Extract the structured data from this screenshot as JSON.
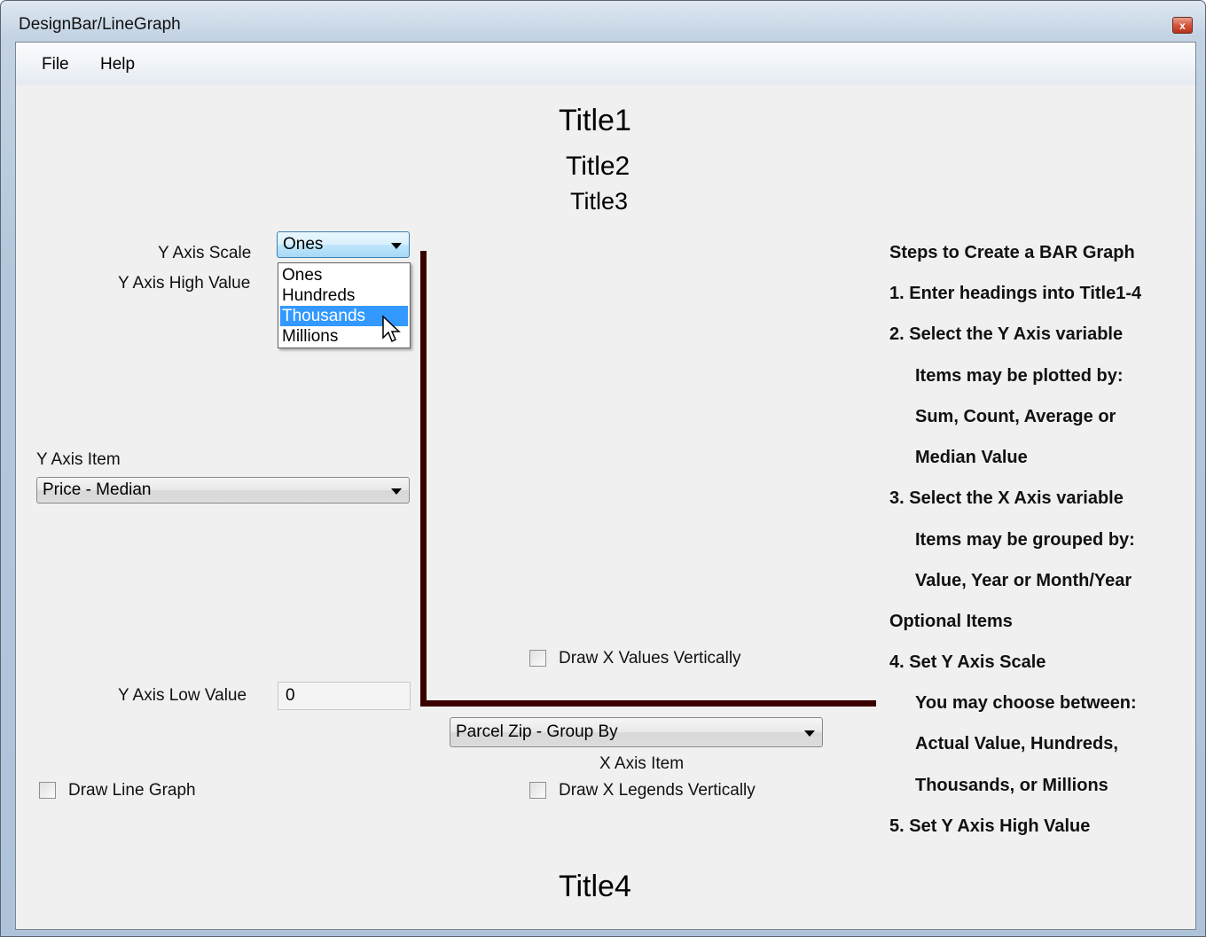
{
  "window": {
    "title": "DesignBar/LineGraph",
    "close_glyph": "x"
  },
  "menu": {
    "file": "File",
    "help": "Help"
  },
  "titles": {
    "title1": "Title1",
    "title2": "Title2",
    "title3": "Title3",
    "title4": "Title4"
  },
  "y_axis": {
    "scale_label": "Y Axis Scale",
    "scale_selected": "Ones",
    "scale_options": [
      "Ones",
      "Hundreds",
      "Thousands",
      "Millions"
    ],
    "scale_highlighted": "Thousands",
    "high_value_label": "Y Axis High Value",
    "item_label": "Y Axis Item",
    "item_selected": "Price - Median",
    "low_value_label": "Y Axis Low Value",
    "low_value": "0"
  },
  "x_axis": {
    "item_selected": "Parcel Zip - Group By",
    "item_label": "X Axis Item",
    "draw_values_vertically": "Draw X Values Vertically",
    "draw_legends_vertically": "Draw X Legends Vertically"
  },
  "draw_line_graph": "Draw Line Graph",
  "checkboxes": {
    "draw_line_graph": false,
    "draw_values_vertically": false,
    "draw_legends_vertically": false
  },
  "axis_color": "#3a0000",
  "steps": [
    "Steps to Create a BAR Graph",
    "1.  Enter headings into Title1-4",
    "2.  Select the Y Axis variable",
    "Items may be plotted by:",
    "Sum, Count, Average or",
    "Median Value",
    "3.  Select the X Axis variable",
    "Items may be grouped by:",
    "Value, Year or Month/Year",
    "Optional Items",
    "4.  Set Y Axis Scale",
    "You may choose between:",
    "Actual Value, Hundreds,",
    "Thousands, or Millions",
    "5.  Set Y Axis High Value"
  ]
}
